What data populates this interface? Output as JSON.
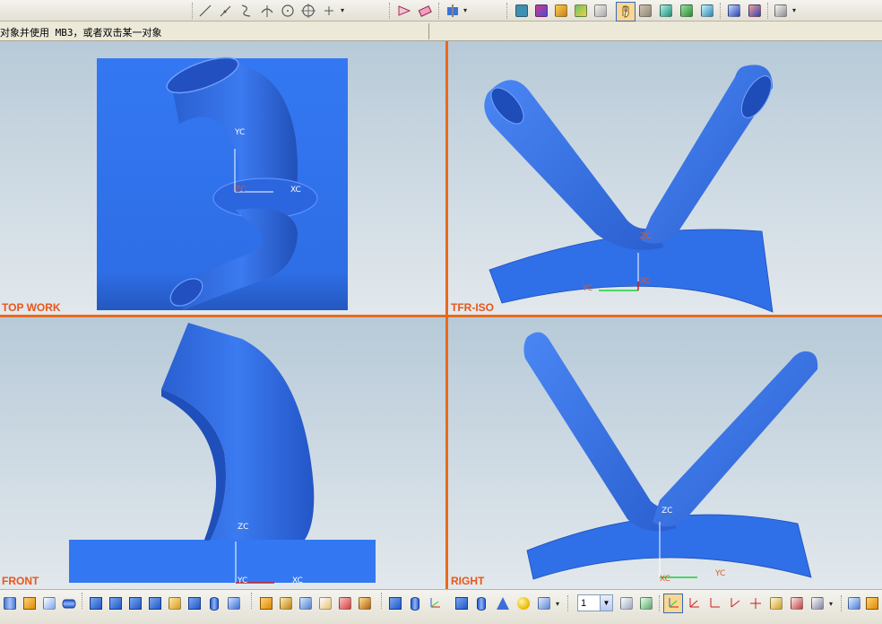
{
  "status": {
    "cue_text": "对象并使用 MB3，或者双击某一对象"
  },
  "viewports": {
    "top_left": {
      "label": "TOP WORK",
      "axes": [
        "YC",
        "ZC",
        "XC"
      ]
    },
    "top_right": {
      "label": "TFR-ISO",
      "axes": [
        "ZC",
        "YC",
        "XC"
      ]
    },
    "bottom_left": {
      "label": "FRONT",
      "axes": [
        "ZC",
        "YC",
        "XC"
      ]
    },
    "bottom_right": {
      "label": "RIGHT",
      "axes": [
        "ZC",
        "XC",
        "YC"
      ]
    }
  },
  "toolbar": {
    "layer_value": "1"
  },
  "colors": {
    "model_blue": "#2f6fe8",
    "viewport_border": "#e86a1c",
    "label_orange": "#e8561a"
  }
}
